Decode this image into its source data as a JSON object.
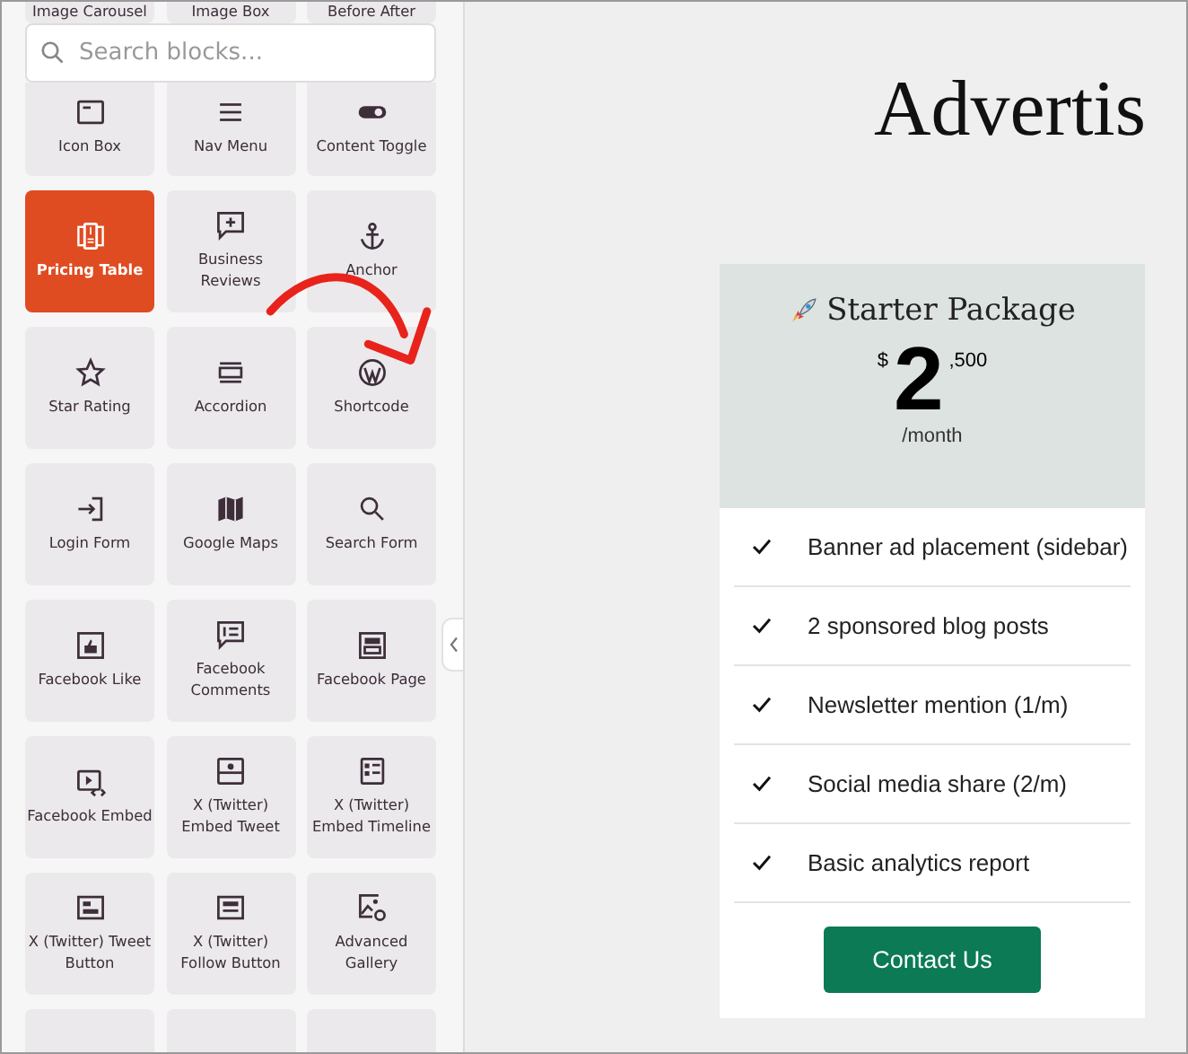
{
  "sidebar": {
    "search": {
      "placeholder": "Search blocks..."
    },
    "blocks": [
      {
        "label": "Image Carousel",
        "selected": false
      },
      {
        "label": "Image Box",
        "selected": false
      },
      {
        "label": "Before After",
        "selected": false
      },
      {
        "label": "Icon Box",
        "selected": false
      },
      {
        "label": "Nav Menu",
        "selected": false
      },
      {
        "label": "Content Toggle",
        "selected": false
      },
      {
        "label": "Pricing Table",
        "selected": true
      },
      {
        "label": "Business Reviews",
        "selected": false
      },
      {
        "label": "Anchor",
        "selected": false
      },
      {
        "label": "Star Rating",
        "selected": false
      },
      {
        "label": "Accordion",
        "selected": false
      },
      {
        "label": "Shortcode",
        "selected": false
      },
      {
        "label": "Login Form",
        "selected": false
      },
      {
        "label": "Google Maps",
        "selected": false
      },
      {
        "label": "Search Form",
        "selected": false
      },
      {
        "label": "Facebook Like",
        "selected": false
      },
      {
        "label": "Facebook Comments",
        "selected": false
      },
      {
        "label": "Facebook Page",
        "selected": false
      },
      {
        "label": "Facebook Embed",
        "selected": false
      },
      {
        "label": "X (Twitter) Embed Tweet",
        "selected": false
      },
      {
        "label": "X (Twitter) Embed Timeline",
        "selected": false
      },
      {
        "label": "X (Twitter) Tweet Button",
        "selected": false
      },
      {
        "label": "X (Twitter) Follow Button",
        "selected": false
      },
      {
        "label": "Advanced Gallery",
        "selected": false
      },
      {
        "selected": false
      },
      {
        "selected": false
      },
      {
        "selected": false
      }
    ]
  },
  "canvas": {
    "heading": "Advertis",
    "pricing_card": {
      "title": "Starter Package",
      "currency": "$",
      "price": "2",
      "cents": ",500",
      "period": "/month",
      "features": [
        "Banner ad placement (sidebar)",
        "2 sponsored blog posts",
        "Newsletter mention (1/m)",
        "Social media share (2/m)",
        "Basic analytics report"
      ],
      "button": "Contact Us"
    }
  }
}
